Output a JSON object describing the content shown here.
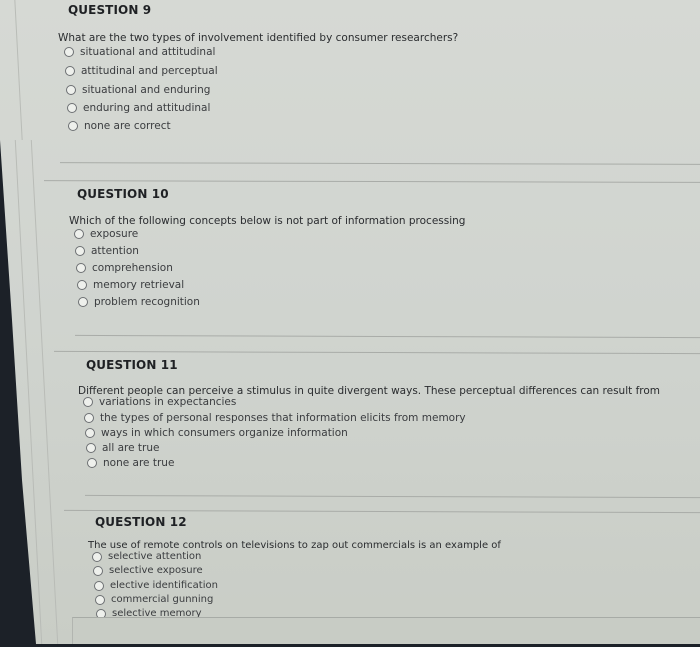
{
  "questions": [
    {
      "title": "QUESTION 9",
      "prompt": "What are the two types of involvement identified by consumer researchers?",
      "options": [
        "situational and attitudinal",
        "attitudinal and perceptual",
        "situational and enduring",
        "enduring and attitudinal",
        "none are correct"
      ]
    },
    {
      "title": "QUESTION 10",
      "prompt": "Which of the following concepts below is not part of information processing",
      "options": [
        "exposure",
        "attention",
        "comprehension",
        "memory retrieval",
        "problem recognition"
      ]
    },
    {
      "title": "QUESTION 11",
      "prompt": "Different people can perceive a stimulus in quite divergent ways. These perceptual differences can result from",
      "options": [
        "variations in expectancies",
        "the types of personal responses that information elicits from memory",
        "ways in which consumers organize information",
        "all are true",
        "none are true"
      ]
    },
    {
      "title": "QUESTION 12",
      "prompt": "The use of remote controls on televisions to zap out commercials is an example of",
      "options": [
        "selective attention",
        "selective exposure",
        "elective identification",
        "commercial gunning",
        "selective memory"
      ]
    }
  ]
}
